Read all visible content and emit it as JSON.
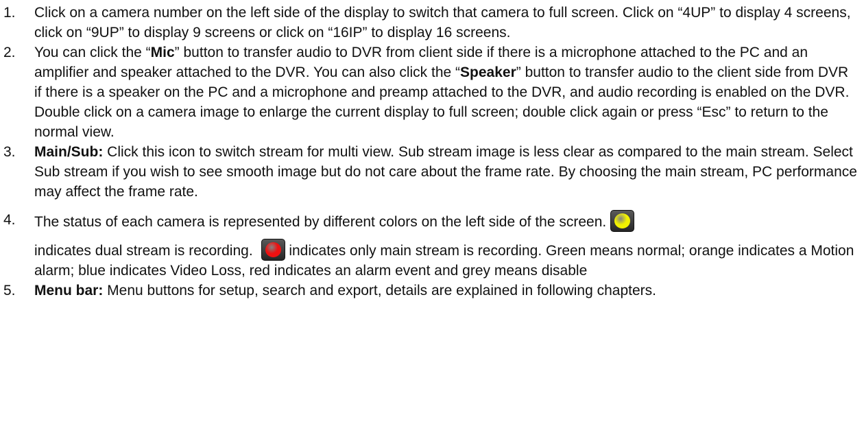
{
  "items": [
    {
      "number": "1.",
      "text": "Click on a camera number on the left side of the display to switch that camera to full screen. Click on “4UP” to display 4 screens, click on “9UP” to display 9 screens or click on “16IP” to display 16 screens."
    },
    {
      "number": "2.",
      "part1": "You can click the “",
      "bold1": "Mic",
      "part2": "” button to transfer audio to DVR from client side if there is a microphone attached to the PC and an amplifier and speaker attached to the DVR. You can also click the “",
      "bold2": "Speaker",
      "part3": "” button to transfer audio to the client side from DVR if there is a speaker on the PC and a microphone and preamp attached to the DVR, and audio recording is enabled on the DVR. Double click on a camera image to enlarge the current display to full screen; double click again or press “Esc” to return to the normal view."
    },
    {
      "number": "3.",
      "bold": "Main/Sub:",
      "text": " Click this icon to switch stream for multi view.  Sub stream image is less clear as compared to the main stream.  Select Sub stream if you wish to see smooth image but do not care about the frame rate. By choosing the main stream, PC performance may affect the frame rate."
    },
    {
      "number": "4.",
      "text1": "The status of each camera is represented by different colors on the left side of the screen.",
      "text2": " indicates dual stream is recording. ",
      "text3": " indicates only main stream is recording. Green means normal; orange indicates a Motion alarm; blue indicates Video Loss, red indicates an alarm event and grey means disable",
      "icon_dual": "yellow-status-icon",
      "icon_main": "red-status-icon",
      "color_dual": "#f2f200",
      "color_main": "#ee1111"
    },
    {
      "number": "5.",
      "bold": "Menu bar:",
      "text": " Menu buttons for setup, search and export, details are explained in following chapters."
    }
  ]
}
